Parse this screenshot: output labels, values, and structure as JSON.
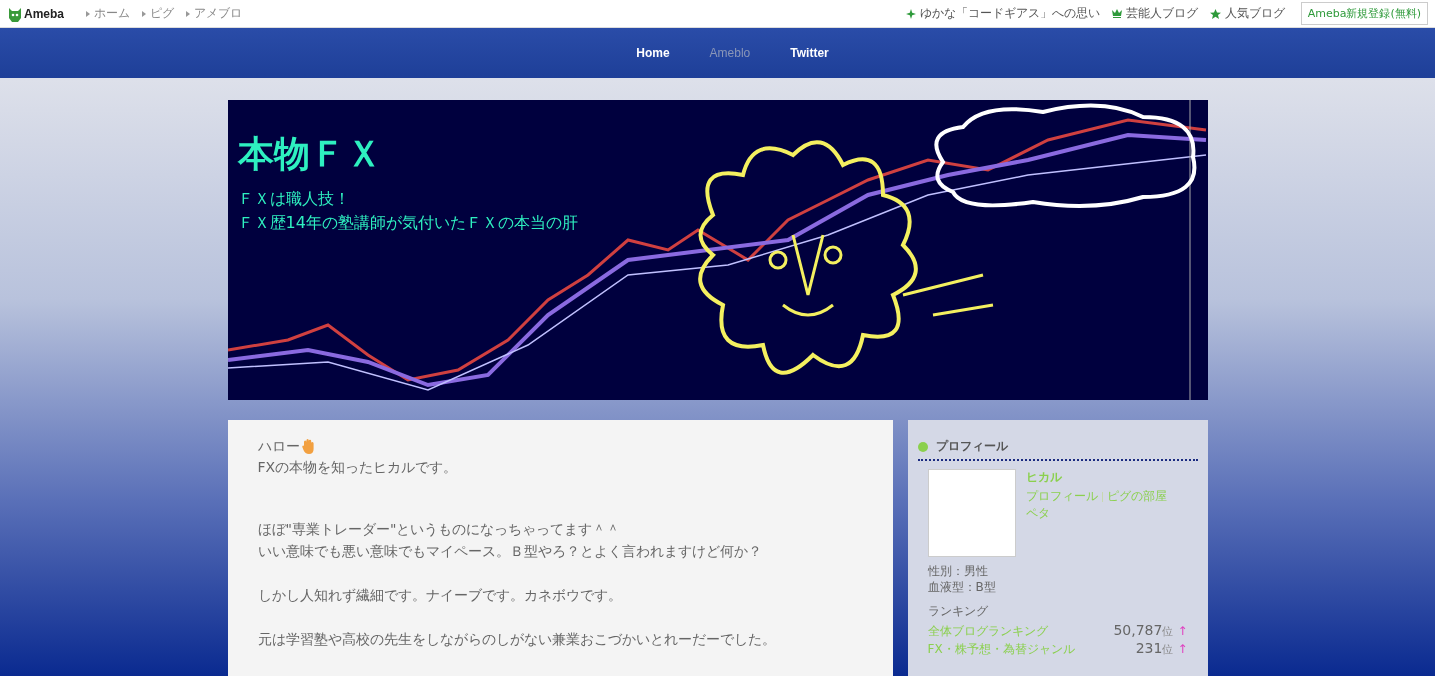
{
  "top_bar": {
    "logo": "Ameba",
    "breadcrumbs": [
      "ホーム",
      "ピグ",
      "アメブロ"
    ],
    "links": [
      {
        "label": "ゆかな「コードギアス」への思い",
        "kind": "sparkle"
      },
      {
        "label": "芸能人ブログ",
        "kind": "crown"
      },
      {
        "label": "人気ブログ",
        "kind": "star"
      }
    ],
    "signup_button": "Ameba新規登録(無料)"
  },
  "nav": {
    "items": [
      {
        "label": "Home",
        "selected": false
      },
      {
        "label": "Ameblo",
        "selected": true
      },
      {
        "label": "Twitter",
        "selected": false
      }
    ]
  },
  "banner": {
    "title": "本物ＦＸ",
    "description": [
      "ＦＸは職人技！",
      "ＦＸ歴14年の塾講師が気付いたＦＸの本当の肝"
    ]
  },
  "article": {
    "greeting": "ハロー",
    "paragraphs": [
      [
        "FXの本物を知ったヒカルです。"
      ],
      [
        "ほぼ\"専業トレーダー\"というものになっちゃってます＾＾",
        "いい意味でも悪い意味でもマイペース。Ｂ型やろ？とよく言われますけど何か？"
      ],
      [
        "しかし人知れず繊細です。ナイーブです。カネボウです。"
      ],
      [
        "元は学習塾や高校の先生をしながらのしがない兼業おこづかいとれーだーでした。"
      ]
    ]
  },
  "profile": {
    "heading": "プロフィール",
    "name": "ヒカル",
    "links": [
      "プロフィール",
      "ピグの部屋",
      "ペタ"
    ],
    "details": [
      "性別：男性",
      "血液型：B型"
    ],
    "ranking_heading": "ランキング",
    "rankings": [
      {
        "label": "全体ブログランキング",
        "rank": "50,787",
        "unit": "位",
        "trend": "↑"
      },
      {
        "label": "FX・株予想・為替ジャンル",
        "rank": "231",
        "unit": "位",
        "trend": "↑"
      }
    ]
  }
}
